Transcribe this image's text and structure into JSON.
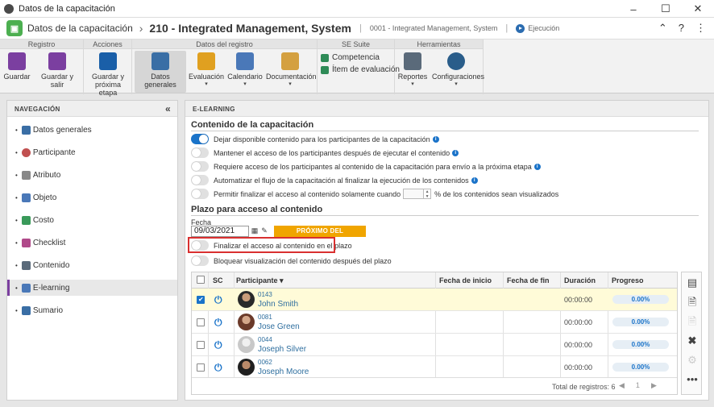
{
  "window": {
    "title": "Datos de la capacitación",
    "controls": [
      "–",
      "☐",
      "✕"
    ]
  },
  "header": {
    "app_name": "Datos de la capacitación",
    "record_title": "210 - Integrated Management, System",
    "record_code": "0001 - Integrated Management, System",
    "status": "Ejecución"
  },
  "ribbon": {
    "groups": [
      "Registro",
      "Acciones",
      "Datos del registro",
      "SE Suite",
      "Herramientas"
    ],
    "guardar": "Guardar",
    "guardar_salir": "Guardar y salir",
    "guardar_prox_1": "Guardar y",
    "guardar_prox_2": "próxima etapa",
    "datos_generales": "Datos generales",
    "evaluacion": "Evaluación",
    "calendario": "Calendario",
    "documentacion": "Documentación",
    "competencia": "Competencia",
    "item_evaluacion": "Ítem de evaluación",
    "reportes": "Reportes",
    "configuraciones": "Configuraciones"
  },
  "nav": {
    "title": "NAVEGACIÓN",
    "items": [
      {
        "label": "Datos generales"
      },
      {
        "label": "Participante"
      },
      {
        "label": "Atributo"
      },
      {
        "label": "Objeto"
      },
      {
        "label": "Costo"
      },
      {
        "label": "Checklist"
      },
      {
        "label": "Contenido"
      },
      {
        "label": "E-learning"
      },
      {
        "label": "Sumario"
      }
    ]
  },
  "content": {
    "panel_title": "E-LEARNING",
    "section1": "Contenido de la capacitación",
    "toggles": [
      {
        "label": "Dejar disponible contenido para los participantes de la capacitación",
        "on": true
      },
      {
        "label": "Mantener el acceso de los participantes después de ejecutar el contenido",
        "on": false
      },
      {
        "label": "Requiere acceso de los participantes al contenido de la capacitación para envío a la próxima etapa",
        "on": false
      },
      {
        "label": "Automatizar el flujo de la capacitación al finalizar la ejecución de los contenidos",
        "on": false
      }
    ],
    "allow_label_a": "Permitir finalizar el acceso al contenido solamente cuando",
    "allow_label_b": "% de los contenidos sean visualizados",
    "section2": "Plazo para acceso al contenido",
    "fecha_label": "Fecha",
    "fecha_value": "09/03/2021",
    "badge": "PRÓXIMO DEL VENCIMIENTO",
    "finalizar_label": "Finalizar el acceso al contenido en el plazo",
    "bloquear_label": "Bloquear visualización del contenido después del plazo"
  },
  "table": {
    "headers": {
      "sc": "SC",
      "participante": "Participante",
      "inicio": "Fecha de inicio",
      "fin": "Fecha de fin",
      "duracion": "Duración",
      "progreso": "Progreso"
    },
    "rows": [
      {
        "id": "0143",
        "name": "John Smith",
        "duration": "00:00:00",
        "progress": "0.00%"
      },
      {
        "id": "0081",
        "name": "Jose Green",
        "duration": "00:00:00",
        "progress": "0.00%"
      },
      {
        "id": "0044",
        "name": "Joseph Silver",
        "duration": "00:00:00",
        "progress": "0.00%"
      },
      {
        "id": "0062",
        "name": "Joseph Moore",
        "duration": "00:00:00",
        "progress": "0.00%"
      }
    ],
    "total": "Total de registros: 6",
    "page": "1"
  }
}
